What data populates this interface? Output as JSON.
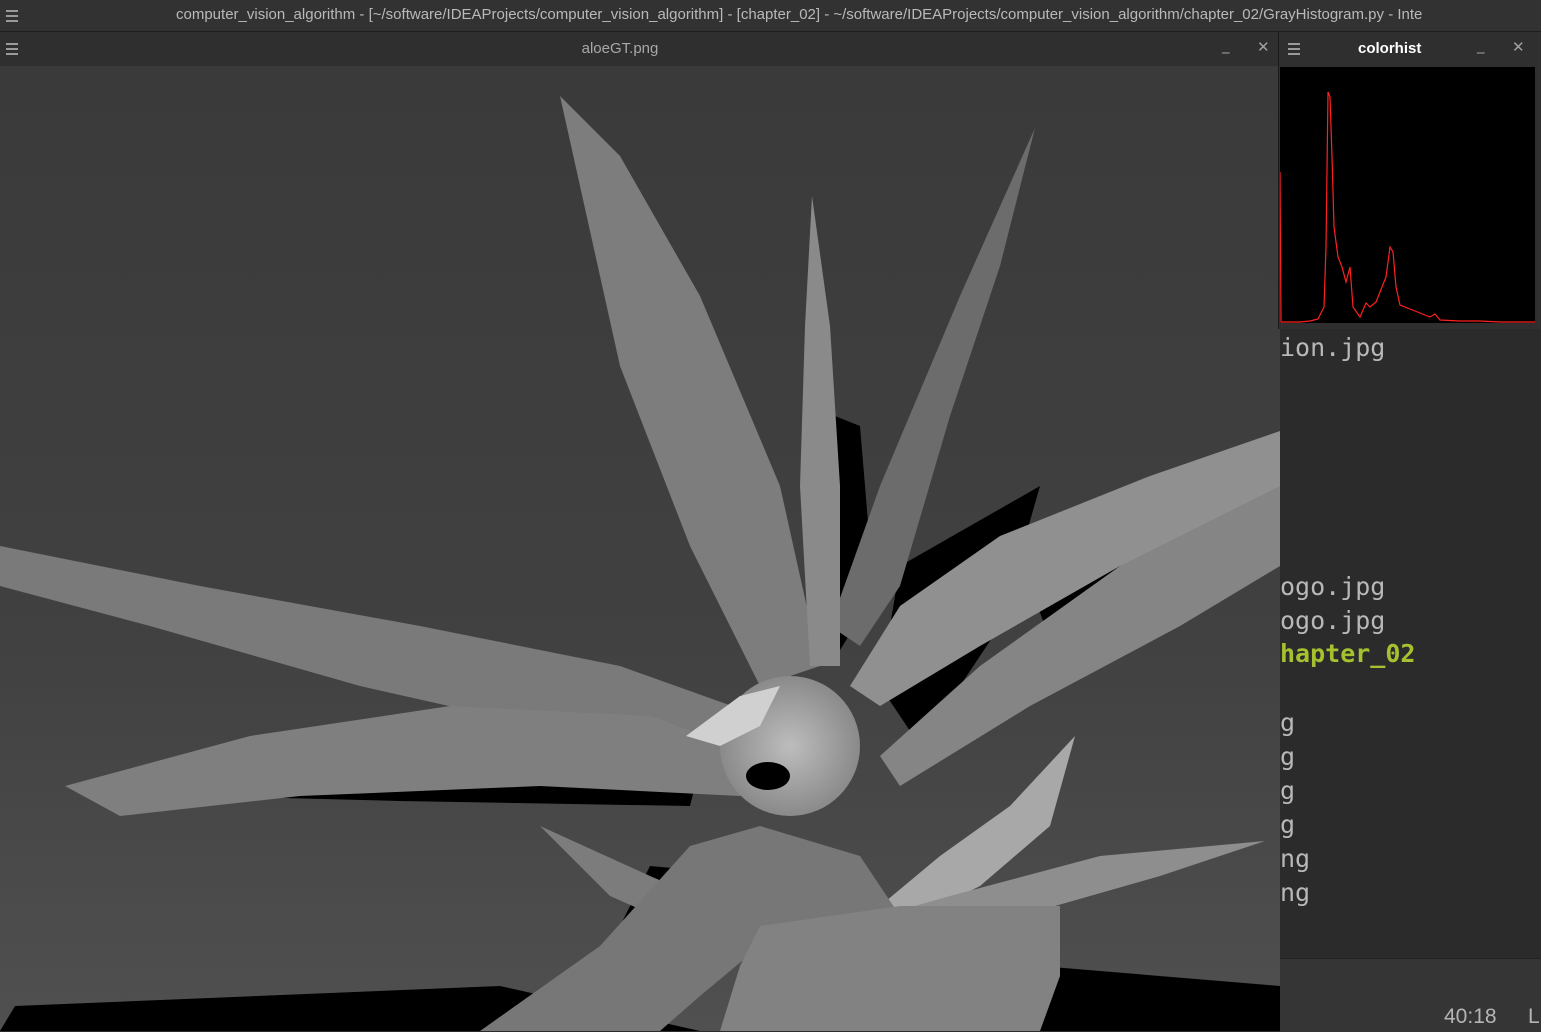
{
  "ide": {
    "title": "computer_vision_algorithm - [~/software/IDEAProjects/computer_vision_algorithm] - [chapter_02] - ~/software/IDEAProjects/computer_vision_algorithm/chapter_02/GrayHistogram.py - Inte"
  },
  "image_window": {
    "title": "aloeGT.png",
    "minimize_icon": "minimize-icon",
    "close_icon": "close-icon"
  },
  "hist_window": {
    "title": "colorhist",
    "line_color": "#ff2020",
    "background": "#000000"
  },
  "editor": {
    "lines": [
      {
        "text": "ion.jpg"
      },
      {
        "text": "ogo.jpg"
      },
      {
        "text": "ogo.jpg"
      },
      {
        "text": "hapter_02"
      },
      {
        "text": "g"
      },
      {
        "text": "g"
      },
      {
        "text": "g"
      },
      {
        "text": "g"
      },
      {
        "text": "ng"
      },
      {
        "text": "ng"
      }
    ]
  },
  "status": {
    "position": "40:18",
    "extra": "L"
  },
  "colors": {
    "ide_background": "#2b2b2b",
    "highlight": "#a6c12f"
  }
}
